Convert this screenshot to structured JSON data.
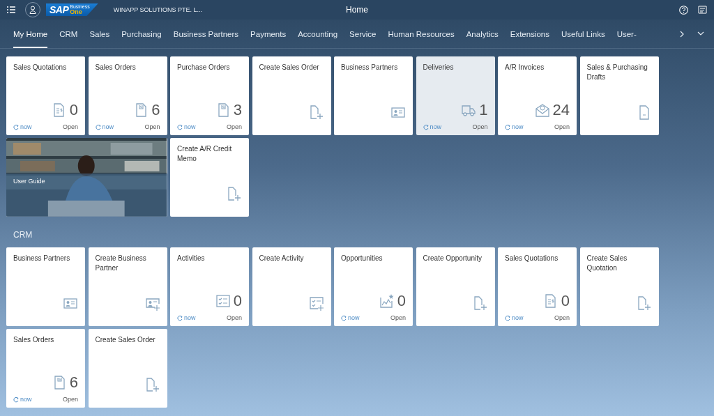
{
  "header": {
    "logo": {
      "brand": "SAP",
      "line_1": "Business",
      "line_2": "One"
    },
    "company": "WINAPP SOLUTIONS PTE. L...",
    "title": "Home"
  },
  "tabs": [
    {
      "label": "My Home",
      "selected": true
    },
    {
      "label": "CRM",
      "selected": false
    },
    {
      "label": "Sales",
      "selected": false
    },
    {
      "label": "Purchasing",
      "selected": false
    },
    {
      "label": "Business Partners",
      "selected": false
    },
    {
      "label": "Payments",
      "selected": false
    },
    {
      "label": "Accounting",
      "selected": false
    },
    {
      "label": "Service",
      "selected": false
    },
    {
      "label": "Human Resources",
      "selected": false
    },
    {
      "label": "Analytics",
      "selected": false
    },
    {
      "label": "Extensions",
      "selected": false
    },
    {
      "label": "Useful Links",
      "selected": false
    },
    {
      "label": "User-",
      "selected": false
    }
  ],
  "sections": [
    {
      "tiles": [
        {
          "kind": "counter",
          "title": "Sales Quotations",
          "count": "0",
          "refresh": "now",
          "action": "Open",
          "hovered": false
        },
        {
          "kind": "counter",
          "title": "Sales Orders",
          "count": "6",
          "refresh": "now",
          "action": "Open",
          "hovered": false
        },
        {
          "kind": "counter",
          "title": "Purchase Orders",
          "count": "3",
          "refresh": "now",
          "action": "Open",
          "hovered": false
        },
        {
          "kind": "launch",
          "title": "Create Sales Order",
          "hovered": false
        },
        {
          "kind": "launch",
          "title": "Business Partners",
          "hovered": false
        },
        {
          "kind": "counter",
          "title": "Deliveries",
          "count": "1",
          "refresh": "now",
          "action": "Open",
          "hovered": true
        },
        {
          "kind": "counter",
          "title": "A/R Invoices",
          "count": "24",
          "refresh": "now",
          "action": "Open",
          "hovered": false
        },
        {
          "kind": "launch",
          "title": "Sales & Purchasing Drafts",
          "hovered": false
        },
        {
          "kind": "picture",
          "title": "User Guide"
        },
        {
          "kind": "launch",
          "title": "Create A/R Credit Memo",
          "hovered": false
        }
      ]
    },
    {
      "title": "CRM",
      "tiles": [
        {
          "kind": "launch",
          "title": "Business Partners",
          "hovered": false
        },
        {
          "kind": "launch",
          "title": "Create Business Partner",
          "hovered": false
        },
        {
          "kind": "counter",
          "title": "Activities",
          "count": "0",
          "refresh": "now",
          "action": "Open",
          "hovered": false
        },
        {
          "kind": "launch",
          "title": "Create Activity",
          "hovered": false
        },
        {
          "kind": "counter",
          "title": "Opportunities",
          "count": "0",
          "refresh": "now",
          "action": "Open",
          "hovered": false
        },
        {
          "kind": "launch",
          "title": "Create Opportunity",
          "hovered": false
        },
        {
          "kind": "counter",
          "title": "Sales Quotations",
          "count": "0",
          "refresh": "now",
          "action": "Open",
          "hovered": false
        },
        {
          "kind": "launch",
          "title": "Create Sales Quotation",
          "hovered": false
        },
        {
          "kind": "counter",
          "title": "Sales Orders",
          "count": "6",
          "refresh": "now",
          "action": "Open",
          "hovered": false
        },
        {
          "kind": "launch",
          "title": "Create Sales Order",
          "hovered": false
        }
      ]
    }
  ]
}
